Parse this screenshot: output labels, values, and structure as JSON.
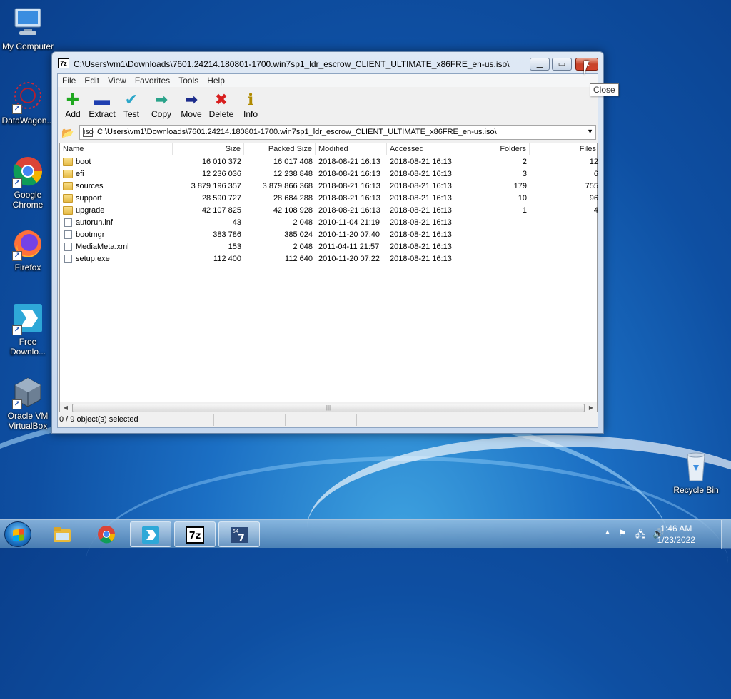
{
  "desktop": {
    "icons": [
      {
        "label": "My Computer",
        "glyph": "🖥"
      },
      {
        "label": "DataWagon...",
        "glyph": "✳"
      },
      {
        "label": "Google Chrome",
        "glyph": ""
      },
      {
        "label": "Firefox",
        "glyph": ""
      },
      {
        "label": "Free Downlo...",
        "glyph": "⇒"
      },
      {
        "label": "Oracle VM VirtualBox",
        "glyph": "▣"
      },
      {
        "label": "Recycle Bin",
        "glyph": "🗑"
      }
    ]
  },
  "window": {
    "title": "C:\\Users\\vm1\\Downloads\\7601.24214.180801-1700.win7sp1_ldr_escrow_CLIENT_ULTIMATE_x86FRE_en-us.iso\\",
    "app_icon": "7z",
    "menu": [
      "File",
      "Edit",
      "View",
      "Favorites",
      "Tools",
      "Help"
    ],
    "toolbar": [
      {
        "label": "Add",
        "icon": "plus-icon",
        "glyph": "✚",
        "color": "#1fa81f"
      },
      {
        "label": "Extract",
        "icon": "minus-icon",
        "glyph": "▬",
        "color": "#1f3fb0"
      },
      {
        "label": "Test",
        "icon": "check-chevron-icon",
        "glyph": "✔",
        "color": "#2aa6c9"
      },
      {
        "label": "Copy",
        "icon": "copy-arrow-icon",
        "glyph": "➡",
        "color": "#2aa38a"
      },
      {
        "label": "Move",
        "icon": "move-arrow-icon",
        "glyph": "➡",
        "color": "#1c2c8c"
      },
      {
        "label": "Delete",
        "icon": "delete-x-icon",
        "glyph": "✖",
        "color": "#d81e1e"
      },
      {
        "label": "Info",
        "icon": "info-icon",
        "glyph": "ℹ",
        "color": "#b08a00"
      }
    ],
    "address": "C:\\Users\\vm1\\Downloads\\7601.24214.180801-1700.win7sp1_ldr_escrow_CLIENT_ULTIMATE_x86FRE_en-us.iso\\",
    "columns": [
      "Name",
      "Size",
      "Packed Size",
      "Modified",
      "Accessed",
      "Folders",
      "Files"
    ],
    "rows": [
      {
        "type": "folder",
        "name": "boot",
        "size": "16 010 372",
        "packed": "16 017 408",
        "modified": "2018-08-21 16:13",
        "accessed": "2018-08-21 16:13",
        "folders": "2",
        "files": "12"
      },
      {
        "type": "folder",
        "name": "efi",
        "size": "12 236 036",
        "packed": "12 238 848",
        "modified": "2018-08-21 16:13",
        "accessed": "2018-08-21 16:13",
        "folders": "3",
        "files": "6"
      },
      {
        "type": "folder",
        "name": "sources",
        "size": "3 879 196 357",
        "packed": "3 879 866 368",
        "modified": "2018-08-21 16:13",
        "accessed": "2018-08-21 16:13",
        "folders": "179",
        "files": "755"
      },
      {
        "type": "folder",
        "name": "support",
        "size": "28 590 727",
        "packed": "28 684 288",
        "modified": "2018-08-21 16:13",
        "accessed": "2018-08-21 16:13",
        "folders": "10",
        "files": "96"
      },
      {
        "type": "folder",
        "name": "upgrade",
        "size": "42 107 825",
        "packed": "42 108 928",
        "modified": "2018-08-21 16:13",
        "accessed": "2018-08-21 16:13",
        "folders": "1",
        "files": "4"
      },
      {
        "type": "file",
        "name": "autorun.inf",
        "size": "43",
        "packed": "2 048",
        "modified": "2010-11-04 21:19",
        "accessed": "2018-08-21 16:13",
        "folders": "",
        "files": ""
      },
      {
        "type": "file",
        "name": "bootmgr",
        "size": "383 786",
        "packed": "385 024",
        "modified": "2010-11-20 07:40",
        "accessed": "2018-08-21 16:13",
        "folders": "",
        "files": ""
      },
      {
        "type": "file",
        "name": "MediaMeta.xml",
        "size": "153",
        "packed": "2 048",
        "modified": "2011-04-11 21:57",
        "accessed": "2018-08-21 16:13",
        "folders": "",
        "files": ""
      },
      {
        "type": "file",
        "name": "setup.exe",
        "size": "112 400",
        "packed": "112 640",
        "modified": "2010-11-20 07:22",
        "accessed": "2018-08-21 16:13",
        "folders": "",
        "files": ""
      }
    ],
    "status": "0 / 9 object(s) selected",
    "tooltip": "Close"
  },
  "taskbar": {
    "time": "1:46 AM",
    "date": "1/23/2022",
    "items": [
      "explorer-folder-icon",
      "chrome-icon",
      "free-download-manager-icon",
      "7zip-icon",
      "7zip-x64-icon"
    ]
  }
}
